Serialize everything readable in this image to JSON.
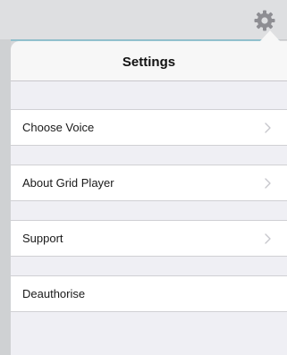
{
  "popover": {
    "title": "Settings"
  },
  "settings_rows": [
    {
      "label": "Choose Voice",
      "has_chevron": true
    },
    {
      "label": "About Grid Player",
      "has_chevron": true
    },
    {
      "label": "Support",
      "has_chevron": true
    },
    {
      "label": "Deauthorise",
      "has_chevron": false
    }
  ],
  "icons": {
    "settings_button": "gear-icon",
    "row_disclosure": "chevron-right-icon"
  },
  "colors": {
    "group_background": "#efeff4",
    "row_background": "#ffffff",
    "separator": "#d0d0d4",
    "chevron": "#c7c7cc",
    "gear": "#8e8e93"
  }
}
